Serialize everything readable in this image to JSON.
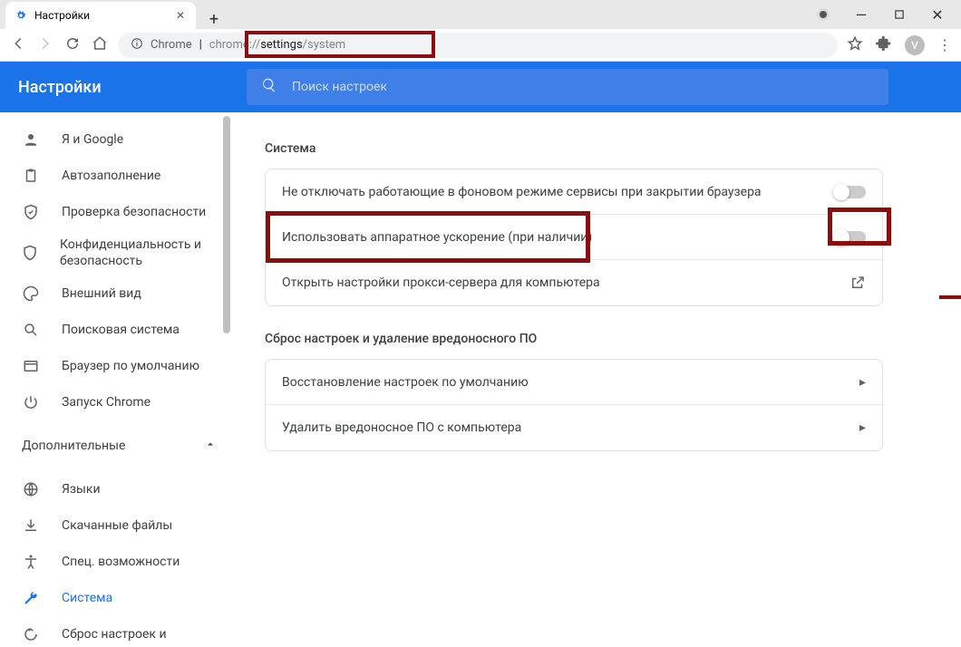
{
  "window": {
    "tab_title": "Настройки",
    "new_tab_plus": "+",
    "minimize": "—",
    "maximize": "▢",
    "close": "✕"
  },
  "toolbar": {
    "back": "←",
    "forward": "→",
    "reload": "⟳",
    "home": "⌂",
    "secure_label": "Chrome",
    "url_prefix": "chrome://",
    "url_bold": "settings",
    "url_suffix": "/system",
    "url_full": "chrome://settings/system",
    "star": "☆",
    "extensions": "✦",
    "avatar_letter": "V",
    "menu": "⋮"
  },
  "header": {
    "title": "Настройки",
    "search_placeholder": "Поиск настроек"
  },
  "sidebar": {
    "items": [
      {
        "icon": "person",
        "label": "Я и Google"
      },
      {
        "icon": "clipboard",
        "label": "Автозаполнение"
      },
      {
        "icon": "shield-check",
        "label": "Проверка безопасности"
      },
      {
        "icon": "shield",
        "label": "Конфиденциальность и безопасность"
      },
      {
        "icon": "palette",
        "label": "Внешний вид"
      },
      {
        "icon": "search",
        "label": "Поисковая система"
      },
      {
        "icon": "window",
        "label": "Браузер по умолчанию"
      },
      {
        "icon": "power",
        "label": "Запуск Chrome"
      }
    ],
    "advanced_label": "Дополнительные",
    "advanced_items": [
      {
        "icon": "globe",
        "label": "Языки"
      },
      {
        "icon": "download",
        "label": "Скачанные файлы"
      },
      {
        "icon": "accessibility",
        "label": "Спец. возможности"
      },
      {
        "icon": "wrench",
        "label": "Система",
        "selected": true
      },
      {
        "icon": "restore",
        "label": "Сброс настроек и"
      }
    ]
  },
  "content": {
    "system_title": "Система",
    "rows": [
      {
        "label": "Не отключать работающие в фоновом режиме сервисы при закрытии браузера",
        "type": "toggle",
        "value": false
      },
      {
        "label": "Использовать аппаратное ускорение (при наличии)",
        "type": "toggle",
        "value": false,
        "highlight": true
      },
      {
        "label": "Открыть настройки прокси-сервера для компьютера",
        "type": "external"
      }
    ],
    "reset_title": "Сброс настроек и удаление вредоносного ПО",
    "reset_rows": [
      {
        "label": "Восстановление настроек по умолчанию"
      },
      {
        "label": "Удалить вредоносное ПО с компьютера"
      }
    ]
  }
}
